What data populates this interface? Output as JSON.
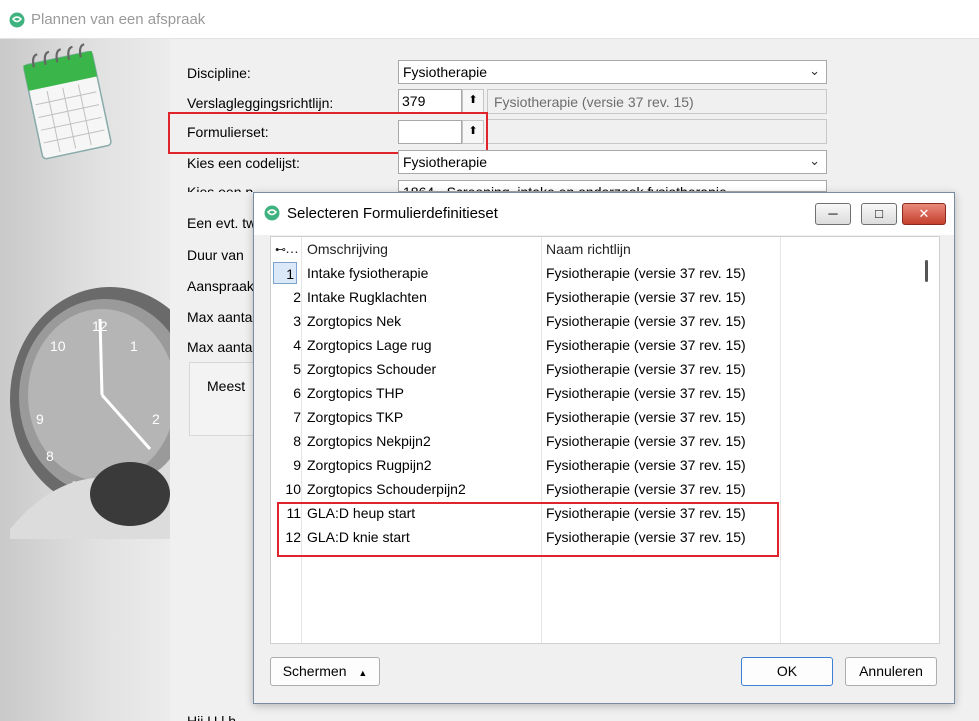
{
  "window": {
    "title": "Plannen van een afspraak"
  },
  "form": {
    "discipline_label": "Discipline:",
    "discipline_value": "Fysiotherapie",
    "richtlijn_label": "Verslagleggingsrichtlijn:",
    "richtlijn_number": "379",
    "richtlijn_name": "Fysiotherapie (versie 37 rev. 15)",
    "formulierset_label": "Formulierset:",
    "formulierset_value": "",
    "codelijst_label": "Kies een codelijst:",
    "codelijst_value": "Fysiotherapie",
    "prestatie_label": "Kies een p",
    "prestatie_value": "1864 - Screening, intake en onderzoek fysiotherapie",
    "tw_label": "Een evt. tw",
    "duur_label": "Duur van",
    "aanspraak_label": "Aanspraak",
    "max1_label": "Max aanta",
    "max2_label": "Max aanta",
    "meest_label": "Meest",
    "bottom_text": "Hij    U  l  h  "
  },
  "dialog": {
    "title": "Selecteren Formulierdefinitieset",
    "columns": {
      "num": "…",
      "omschrijving": "Omschrijving",
      "richtlijn": "Naam richtlijn"
    },
    "rows": [
      {
        "num": "1",
        "omschrijving": "Intake fysiotherapie",
        "richtlijn": "Fysiotherapie (versie 37 rev. 15)"
      },
      {
        "num": "2",
        "omschrijving": "Intake Rugklachten",
        "richtlijn": "Fysiotherapie (versie 37 rev. 15)"
      },
      {
        "num": "3",
        "omschrijving": "Zorgtopics Nek",
        "richtlijn": "Fysiotherapie (versie 37 rev. 15)"
      },
      {
        "num": "4",
        "omschrijving": "Zorgtopics Lage rug",
        "richtlijn": "Fysiotherapie (versie 37 rev. 15)"
      },
      {
        "num": "5",
        "omschrijving": "Zorgtopics Schouder",
        "richtlijn": "Fysiotherapie (versie 37 rev. 15)"
      },
      {
        "num": "6",
        "omschrijving": "Zorgtopics THP",
        "richtlijn": "Fysiotherapie (versie 37 rev. 15)"
      },
      {
        "num": "7",
        "omschrijving": "Zorgtopics TKP",
        "richtlijn": "Fysiotherapie (versie 37 rev. 15)"
      },
      {
        "num": "8",
        "omschrijving": "Zorgtopics Nekpijn2",
        "richtlijn": "Fysiotherapie (versie 37 rev. 15)"
      },
      {
        "num": "9",
        "omschrijving": "Zorgtopics Rugpijn2",
        "richtlijn": "Fysiotherapie (versie 37 rev. 15)"
      },
      {
        "num": "10",
        "omschrijving": "Zorgtopics Schouderpijn2",
        "richtlijn": "Fysiotherapie (versie 37 rev. 15)"
      },
      {
        "num": "11",
        "omschrijving": "GLA:D heup start",
        "richtlijn": "Fysiotherapie (versie 37 rev. 15)"
      },
      {
        "num": "12",
        "omschrijving": "GLA:D knie start",
        "richtlijn": "Fysiotherapie (versie 37 rev. 15)"
      }
    ],
    "schermen_label": "Schermen",
    "ok_label": "OK",
    "cancel_label": "Annuleren"
  },
  "colors": {
    "highlight_red": "#e0242b",
    "app_green": "#3fb37f"
  }
}
